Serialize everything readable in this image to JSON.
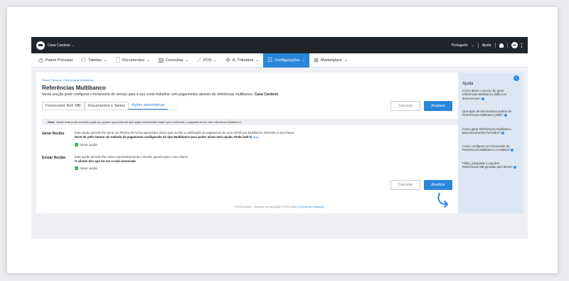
{
  "topbar": {
    "company": "Casa Cardoso",
    "language": "Português",
    "help": "Ajuda"
  },
  "menu": [
    {
      "label": "Painel Principal",
      "icon": "clock-icon",
      "caret": ""
    },
    {
      "label": "Tabelas",
      "icon": "users-icon",
      "caret": "⌄"
    },
    {
      "label": "Documentos",
      "icon": "document-icon",
      "caret": "⌄"
    },
    {
      "label": "Consultas",
      "icon": "chart-icon",
      "caret": "⌄"
    },
    {
      "label": "POS",
      "icon": "pos-icon",
      "caret": "⌄"
    },
    {
      "label": "A. Tributária",
      "icon": "tax-icon",
      "caret": "⌄"
    },
    {
      "label": "Configurações",
      "icon": "settings-icon",
      "caret": "⌄"
    },
    {
      "label": "Marketplace",
      "icon": "grid-icon",
      "caret": "⌄"
    }
  ],
  "breadcrumb": "Painel Principal  ›  Referências Multibanco",
  "title": "Referências Multibanco",
  "subtitle_prefix": "Nesta secção pode configurar o fornecedor do serviço para a sua conta trabalhar com pagamentos através de referências multibanco.",
  "subtitle_company": "Casa Cardoso",
  "tabs": [
    "Fornecedor Ref. MB",
    "Documentos e Séries",
    "Ações automáticas"
  ],
  "buttons": {
    "cancel": "Cancelar",
    "update": "Atualizar"
  },
  "note": {
    "label": "Nota:",
    "text": "Neste local pode escolher quais as opções que pretende que sejam executadas assim que é efetuado o pagamento de uma referência Multibanco."
  },
  "gerar": {
    "label": "Gerar Recibo",
    "text": "Esta opção permite-lhe gerar um Recibo de forma automática assim que recebe a notificação do pagamento de uma referência Multibanco referente a uma fatura.",
    "warning": "Deve ter pelo menos um método de pagamento configurado do tipo Multibanco para poder ativar esta opção. Pode fazê-lo",
    "link": "aqui",
    "check": "Ativar opção"
  },
  "enviar": {
    "label": "Enviar Recibo",
    "text": "Esta opção permite-lhe enviar automaticamente o Recibo gerado para o seu cliente.",
    "warning": "O cliente tem que ter um e-mail associado",
    "check": "Ativar opção"
  },
  "footer": {
    "text": "©2023 Moloni - Software de faturação e POS online |",
    "link": "Termos de Utilização"
  },
  "help": {
    "title": "Ajuda",
    "links": [
      "Como ativar o serviço de gerar referências Multibanco (MB) nos documentos?",
      "Que tipos de documentos podem ter Referências Multibanco (MB)?",
      "Como gerar Referências Multibanco para documentos fechados?",
      "Como configurar um fornecedor de Referências Multibanco no Moloni?",
      "Filtrar, pesquisar e exportar Referências MB geradas pelo Moloni"
    ]
  }
}
